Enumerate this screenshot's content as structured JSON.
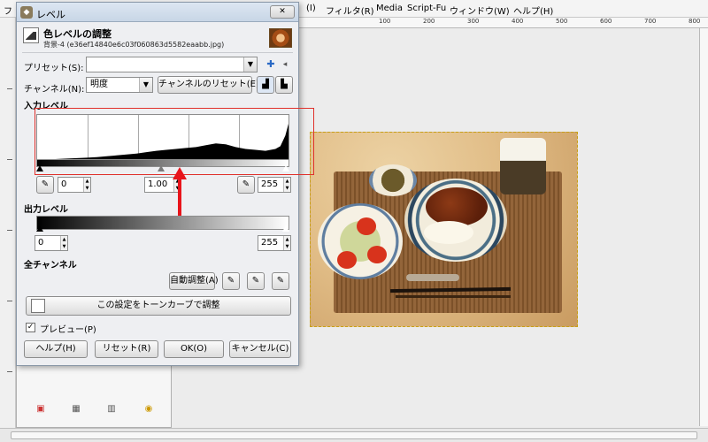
{
  "main_window": {
    "menus": [
      "フ",
      "ァ",
      "フィルタ(R)",
      "Media",
      "Script-Fu",
      "ウィンドウ(W)",
      "ヘルプ(H)"
    ],
    "partial_menu_hidden": "(I)",
    "ruler_labels": [
      "100",
      "200",
      "300",
      "400",
      "500",
      "600",
      "700",
      "800"
    ]
  },
  "dialog": {
    "title": "レベル",
    "close_label": "✕",
    "header_title": "色レベルの調整",
    "header_subtitle": "背景-4 (e36ef14840e6c03f060863d5582eaabb.jpg)",
    "preset_label": "プリセット(S):",
    "preset_value": "",
    "channel_label": "チャンネル(N):",
    "channel_value": "明度",
    "channel_reset_label": "チャンネルのリセット(E)",
    "input_levels_label": "入力レベル",
    "input_low": "0",
    "input_gamma": "1.00",
    "input_high": "255",
    "output_levels_label": "出力レベル",
    "output_low": "0",
    "output_high": "255",
    "all_channels_label": "全チャンネル",
    "auto_label": "自動調整(A)",
    "curves_label": "この設定をトーンカーブで調整",
    "preview_label": "プレビュー(P)",
    "preview_checked": "✓",
    "buttons": {
      "help": "ヘルプ(H)",
      "reset": "リセット(R)",
      "ok": "OK(O)",
      "cancel": "キャンセル(C)"
    }
  },
  "chart_data": {
    "type": "area",
    "title": "",
    "xlabel": "",
    "ylabel": "",
    "xlim": [
      0,
      255
    ],
    "ylim": [
      0,
      1
    ],
    "x": [
      0,
      10,
      20,
      30,
      40,
      50,
      60,
      70,
      80,
      90,
      100,
      110,
      120,
      130,
      140,
      150,
      160,
      170,
      180,
      190,
      200,
      210,
      220,
      230,
      240,
      245,
      250,
      255
    ],
    "values": [
      0.02,
      0.03,
      0.04,
      0.05,
      0.06,
      0.07,
      0.08,
      0.1,
      0.12,
      0.14,
      0.16,
      0.19,
      0.22,
      0.24,
      0.26,
      0.28,
      0.3,
      0.34,
      0.38,
      0.36,
      0.3,
      0.26,
      0.24,
      0.22,
      0.26,
      0.32,
      0.55,
      0.95
    ],
    "grid": true
  },
  "colors": {
    "annotation_red": "#e8141b",
    "highlight_border": "#e0302b"
  }
}
